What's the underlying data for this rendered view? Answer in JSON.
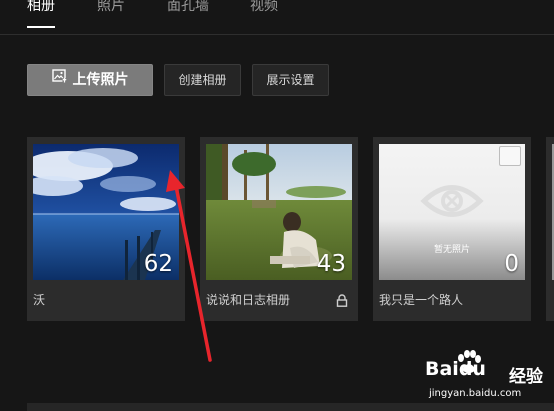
{
  "tabs": [
    {
      "label": "相册",
      "active": true
    },
    {
      "label": "照片",
      "active": false
    },
    {
      "label": "面孔墙",
      "active": false
    },
    {
      "label": "视频",
      "active": false
    }
  ],
  "toolbar": {
    "upload_label": "上传照片",
    "create_label": "创建相册",
    "display_settings_label": "展示设置"
  },
  "albums": [
    {
      "name": "沃",
      "count": "62",
      "cover": "ocean-pier-photo"
    },
    {
      "name": "说说和日志相册",
      "count": "43",
      "cover": "person-sitting-grass-photo",
      "locked": true
    },
    {
      "name": "我只是一个路人",
      "count": "0",
      "cover": "empty-placeholder",
      "empty_text": "暂无照片"
    }
  ],
  "watermark": {
    "brand": "Baidu",
    "text": "经验",
    "url": "jingyan.baidu.com"
  },
  "colors": {
    "background": "#161616",
    "card": "#2c2c2c",
    "upload_button": "#7b7b7b",
    "annotation_arrow": "#e8252c"
  }
}
